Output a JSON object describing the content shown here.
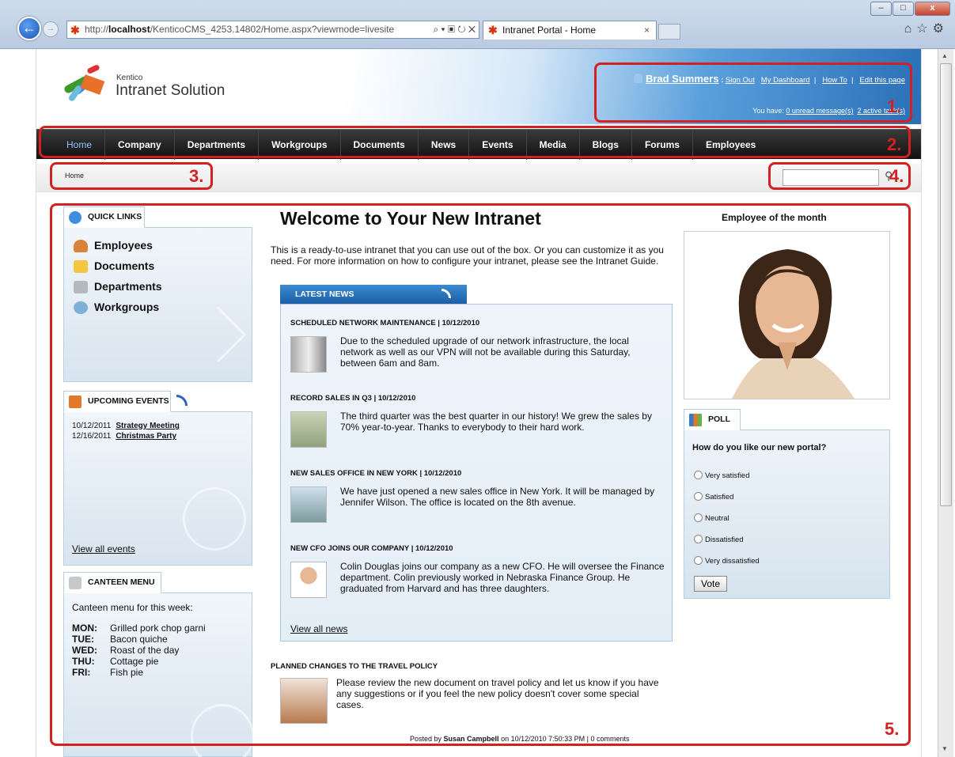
{
  "browser": {
    "url_prefix": "http://",
    "url_host": "localhost",
    "url_rest": "/KenticoCMS_4253.14802/Home.aspx?viewmode=livesite",
    "addr_tools": "⌕ ▾ ▣ ↻ ✕",
    "tab_title": "Intranet Portal - Home",
    "tab_close": "×",
    "title_buttons": [
      "–",
      "□",
      "x"
    ],
    "right_tools": "⌂☆⚙"
  },
  "header": {
    "brand_small": "Kentico",
    "brand_big": "Intranet Solution",
    "user_name": "Brad Summers",
    "user_sep": " : ",
    "links": [
      "Sign Out",
      "My Dashboard",
      "How To",
      "Edit this page"
    ],
    "you_have": "You have: ",
    "messages": "0 unread message(s)",
    "tasks": "2 active task(s)"
  },
  "nav": {
    "items": [
      "Home",
      "Company",
      "Departments",
      "Workgroups",
      "Documents",
      "News",
      "Events",
      "Media",
      "Blogs",
      "Forums",
      "Employees"
    ]
  },
  "breadcrumb": "Home",
  "annotations": [
    "1.",
    "2.",
    "3.",
    "4.",
    "5."
  ],
  "quick_links": {
    "title": "QUICK LINKS",
    "items": [
      "Employees",
      "Documents",
      "Departments",
      "Workgroups"
    ]
  },
  "events": {
    "title": "UPCOMING EVENTS",
    "items": [
      {
        "date": "10/12/2011",
        "name": "Strategy Meeting"
      },
      {
        "date": "12/16/2011",
        "name": "Christmas Party"
      }
    ],
    "view_all": "View all events"
  },
  "canteen": {
    "title": "CANTEEN MENU",
    "intro": "Canteen menu for this week:",
    "days": [
      {
        "day": "MON:",
        "meal": "Grilled pork chop garni"
      },
      {
        "day": "TUE:",
        "meal": "Bacon quiche"
      },
      {
        "day": "WED:",
        "meal": "Roast of the day"
      },
      {
        "day": "THU:",
        "meal": "Cottage pie"
      },
      {
        "day": "FRI:",
        "meal": "Fish pie"
      }
    ]
  },
  "main": {
    "title": "Welcome to Your New Intranet",
    "intro": "This is a ready-to-use intranet that you can use out of the box. Or you can customize it as you need. For more information on how to configure your intranet, please see the Intranet Guide.",
    "news_tab": "LATEST NEWS",
    "news": [
      {
        "title": "SCHEDULED NETWORK MAINTENANCE | 10/12/2010",
        "body": "Due to the scheduled upgrade of our network infrastructure, the local network as well as our VPN will not be available during this Saturday, between 6am and 8am."
      },
      {
        "title": "RECORD SALES IN Q3 | 10/12/2010",
        "body": "The third quarter was the best quarter in our history! We grew the sales by 70% year-to-year. Thanks to everybody to their hard work."
      },
      {
        "title": "NEW SALES OFFICE IN NEW YORK | 10/12/2010",
        "body": "We have just opened a new sales office in New York. It will be managed by Jennifer Wilson. The office is located on the 8th avenue."
      },
      {
        "title": "NEW CFO JOINS OUR COMPANY | 10/12/2010",
        "body": "Colin Douglas joins our company as a new CFO. He will oversee the Finance department. Colin previously worked in Nebraska Finance Group. He graduated from Harvard and has three daughters."
      }
    ],
    "view_all_news": "View all news",
    "blog_title": "PLANNED CHANGES TO THE TRAVEL POLICY",
    "blog_body": "Please review the new document on travel policy and let us know if you have any suggestions or if you feel the new policy doesn't cover some special cases.",
    "posted_by": "Posted by ",
    "author": "Susan Campbell",
    "posted_on": " on 10/12/2010 7:50:33 PM | 0 comments"
  },
  "right": {
    "eom_title": "Employee of the month",
    "poll_title": "POLL",
    "poll_question": "How do you like our new portal?",
    "options": [
      "Very satisfied",
      "Satisfied",
      "Neutral",
      "Dissatisfied",
      "Very dissatisfied"
    ],
    "vote": "Vote"
  }
}
